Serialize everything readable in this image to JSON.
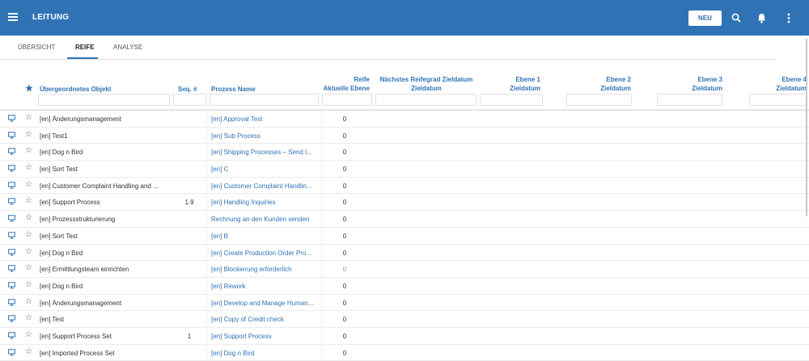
{
  "app": {
    "title": "LEITUNG",
    "new_button": "NEU"
  },
  "tabs": [
    {
      "label": "ÜBERSICHT",
      "active": false
    },
    {
      "label": "REIFE",
      "active": true
    },
    {
      "label": "ANALYSE",
      "active": false
    }
  ],
  "columns": {
    "parent_object": "Übergeordnetes Objekt",
    "seq": "Seq. #",
    "process_name": "Prozess Name",
    "maturity_line1": "Reife",
    "maturity_line2": "Aktuelle Ebene",
    "next_line1": "Nächstes Reifegrad Zieldatum",
    "next_line2": "Zieldatum",
    "level1_line1": "Ebene 1",
    "level1_line2": "Zieldatum",
    "level2_line1": "Ebene 2",
    "level2_line2": "Zieldatum",
    "level3_line1": "Ebene 3",
    "level3_line2": "Zieldatum",
    "level4_line1": "Ebene 4",
    "level4_line2": "Zieldatum"
  },
  "rows": [
    {
      "parent": "[en] Änderungsmanagement",
      "seq": "",
      "process": "[en] Approval Test",
      "level": "0",
      "dim": false
    },
    {
      "parent": "[en] Test1",
      "seq": "",
      "process": "[en] Sub Process",
      "level": "0",
      "dim": false
    },
    {
      "parent": "[en] Dog n Bird",
      "seq": "",
      "process": "[en] Shipping Processes – Send t...",
      "level": "0",
      "dim": false
    },
    {
      "parent": "[en] Sort Test",
      "seq": "",
      "process": "[en] C",
      "level": "0",
      "dim": false
    },
    {
      "parent": "[en] Customer Complaint Handling and ...",
      "seq": "",
      "process": "[en] Customer Complaint Handlin...",
      "level": "0",
      "dim": false
    },
    {
      "parent": "[en] Support Process",
      "seq": "1.9",
      "process": "[en] Handling Inquiries",
      "level": "0",
      "dim": false
    },
    {
      "parent": "[en] Prozessstrukturierung",
      "seq": "",
      "process": "Rechnung an den Kunden senden",
      "level": "0",
      "dim": false
    },
    {
      "parent": "[en] Sort Test",
      "seq": "",
      "process": "[en] B",
      "level": "0",
      "dim": false
    },
    {
      "parent": "[en] Dog n Bird",
      "seq": "",
      "process": "[en] Create Production Order Pro...",
      "level": "0",
      "dim": false
    },
    {
      "parent": "[en] Ermittlungsteam einrichten",
      "seq": "",
      "process": "[en] Blockierung erforderlich",
      "level": "0",
      "dim": true
    },
    {
      "parent": "[en] Dog n Bird",
      "seq": "",
      "process": "[en] Rework",
      "level": "0",
      "dim": false
    },
    {
      "parent": "[en] Änderungsmanagement",
      "seq": "",
      "process": "[en] Develop and Manage Human...",
      "level": "0",
      "dim": false
    },
    {
      "parent": "[en] Test",
      "seq": "",
      "process": "[en] Copy of Credit check",
      "level": "0",
      "dim": false
    },
    {
      "parent": "[en] Support Process Set",
      "seq": "1",
      "process": "[en] Support Process",
      "level": "0",
      "dim": false
    },
    {
      "parent": "[en] Imported Process Set",
      "seq": "",
      "process": "[en] Dog n Bird",
      "level": "0",
      "dim": false
    }
  ],
  "icons": {
    "menu": "menu-icon",
    "search": "search-icon",
    "bell": "bell-icon",
    "more": "more-vert-icon",
    "row_monitor": "monitor-icon",
    "row_star": "star-outline-icon",
    "header_star": "star-filled-icon"
  },
  "colors": {
    "appbar": "#2f73b5",
    "link": "#2f73b5"
  }
}
